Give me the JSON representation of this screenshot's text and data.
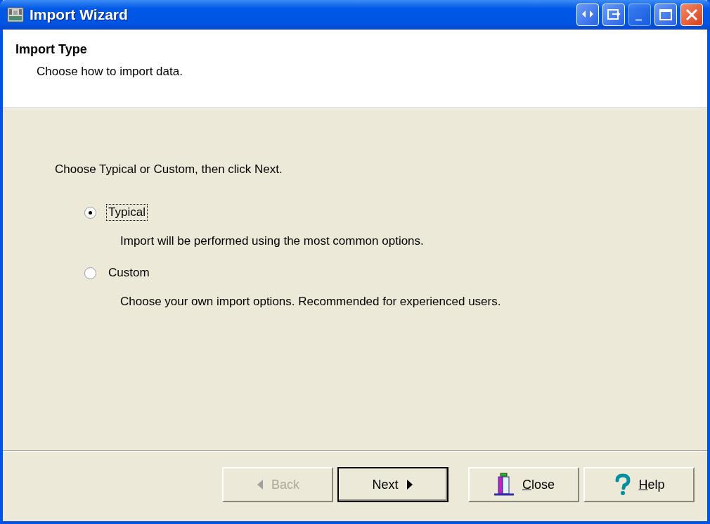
{
  "window": {
    "title": "Import Wizard",
    "controls": [
      {
        "kind": "arrows",
        "disabled": false
      },
      {
        "kind": "exit",
        "disabled": false
      },
      {
        "kind": "minimize",
        "disabled": true
      },
      {
        "kind": "maximize",
        "disabled": false
      },
      {
        "kind": "close",
        "disabled": false
      }
    ]
  },
  "header": {
    "title": "Import Type",
    "subtitle": "Choose how to import data."
  },
  "instruction": "Choose Typical or Custom, then click Next.",
  "options": [
    {
      "label": "Typical",
      "selected": true,
      "focused": true,
      "description": "Import will be performed using the most common options."
    },
    {
      "label": "Custom",
      "selected": false,
      "focused": false,
      "description": "Choose your own import options. Recommended for experienced users."
    }
  ],
  "buttons": [
    {
      "kind": "back",
      "label": "Back",
      "disabled": true,
      "default": false,
      "underlined_first": false
    },
    {
      "kind": "next",
      "label": "Next",
      "disabled": false,
      "default": true,
      "underlined_first": false
    },
    {
      "kind": "close",
      "label": "Close",
      "disabled": false,
      "default": false,
      "underlined_first": true
    },
    {
      "kind": "help",
      "label": "Help",
      "disabled": false,
      "default": false,
      "underlined_first": true
    }
  ]
}
